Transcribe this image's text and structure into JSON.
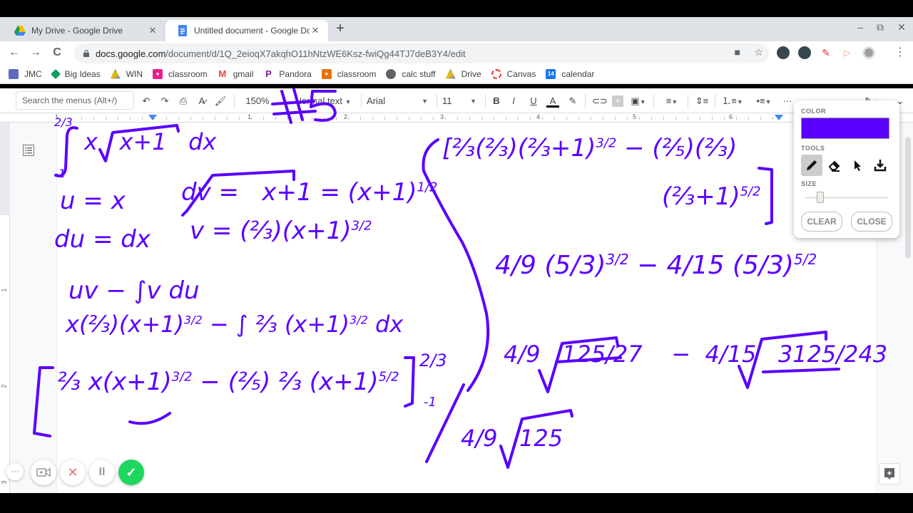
{
  "browser": {
    "tabs": [
      {
        "title": "My Drive - Google Drive",
        "icon": "google-drive-icon",
        "active": false
      },
      {
        "title": "Untitled document - Google Docs",
        "icon": "google-docs-icon",
        "active": true
      }
    ],
    "new_tab_label": "+",
    "window_controls": {
      "minimize": "–",
      "restore": "⧉",
      "close": "✕"
    },
    "nav": {
      "back": "←",
      "forward": "→",
      "reload": "C"
    },
    "url_host": "docs.google.com",
    "url_path": "/document/d/1Q_2eioqX7akqhO11hNtzWE6Ksz-fwiQg44TJ7deB3Y4/edit",
    "menu_label": "⋮",
    "star_label": "☆"
  },
  "bookmarks": [
    {
      "label": "JMC",
      "icon": "jmc-icon",
      "color": "#5c6bc0"
    },
    {
      "label": "Big Ideas",
      "icon": "big-ideas-icon",
      "color": "#0f9d58"
    },
    {
      "label": "WIN",
      "icon": "google-drive-icon",
      "color": "#fbbc04"
    },
    {
      "label": "classroom",
      "icon": "classroom-icon",
      "color": "#e91e8c"
    },
    {
      "label": "gmail",
      "icon": "gmail-icon",
      "color": "#ea4335"
    },
    {
      "label": "Pandora",
      "icon": "pandora-icon",
      "color": "#7b1fa2"
    },
    {
      "label": "classroom",
      "icon": "classroom-icon",
      "color": "#e8710a"
    },
    {
      "label": "calc stuff",
      "icon": "globe-icon",
      "color": "#5f6368"
    },
    {
      "label": "Drive",
      "icon": "google-drive-icon",
      "color": "#34a853"
    },
    {
      "label": "Canvas",
      "icon": "canvas-icon",
      "color": "#e53935"
    },
    {
      "label": "calendar",
      "icon": "calendar-icon",
      "color": "#1a73e8",
      "badge": "14"
    }
  ],
  "toolbar": {
    "search_placeholder": "Search the menus (Alt+/)",
    "zoom": "150%",
    "style": "Normal text",
    "font": "Arial",
    "font_size": "11",
    "bold": "B",
    "italic": "I",
    "underline": "U",
    "text_color": "A",
    "more": "···"
  },
  "ruler": {
    "labels": [
      "1",
      "1",
      "2",
      "3",
      "4",
      "5",
      "6"
    ]
  },
  "vruler": {
    "labels": [
      "1",
      "2",
      "3"
    ]
  },
  "draw_panel": {
    "color_label": "COLOR",
    "color": "#5a00ff",
    "tools_label": "TOOLS",
    "tools": [
      "pencil-icon",
      "eraser-icon",
      "pointer-icon",
      "download-icon"
    ],
    "selected_tool": "pencil",
    "size_label": "SIZE",
    "size_value": 0.15,
    "clear_label": "CLEAR",
    "close_label": "CLOSE"
  },
  "recorder": {
    "more": "···",
    "camera": "camera-icon",
    "cancel": "✕",
    "pause": "II",
    "done": "✓"
  },
  "handwriting": {
    "problem_number": "#5",
    "integral": "∫₋₁^(2/3) x√(x+1) dx",
    "line_u": "u = x",
    "line_du": "du = dx",
    "line_dv": "dv = √(x+1) = (x+1)^(1/2)",
    "line_v": "v = (2/3)(x+1)^(3/2)",
    "ibp_formula": "uv − ∫v du",
    "ibp_step": "x(2/3)(x+1)^(3/2) − ∫ 2/3 (x+1)^(3/2) dx",
    "antiderivative": "[ 2/3 x(x+1)^(3/2) − (2/5)(2/3)(x+1)^(5/2) ] from −1 to 2/3",
    "eval_step1": "2/3(2/3)(2/3+1)^(3/2) − (2/5)(2/3)(2/3+1)^(5/2)",
    "eval_step2": "4/9 (5/3)^(3/2) − 4/15 (5/3)^(5/2)",
    "eval_step3": "4/9 √(125/27) − 4/15 √(3125/243)",
    "eval_step4": "4/9 √125"
  }
}
